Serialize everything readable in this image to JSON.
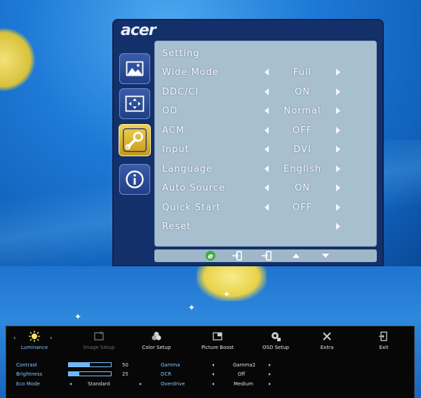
{
  "osd": {
    "brand": "acer",
    "title": "Setting",
    "sidebar": [
      {
        "icon": "picture-icon"
      },
      {
        "icon": "screen-position-icon"
      },
      {
        "icon": "wrench-settings-icon",
        "active": true
      },
      {
        "icon": "info-icon"
      }
    ],
    "rows": [
      {
        "label": "Wide Mode",
        "value": "Full"
      },
      {
        "label": "DDC/CI",
        "value": "ON"
      },
      {
        "label": "OD",
        "value": "Normal"
      },
      {
        "label": "ACM",
        "value": "OFF"
      },
      {
        "label": "Input",
        "value": "DVI"
      },
      {
        "label": "Language",
        "value": "English"
      },
      {
        "label": "Auto Source",
        "value": "ON"
      },
      {
        "label": "Quick Start",
        "value": "OFF"
      },
      {
        "label": "Reset",
        "value": ""
      }
    ],
    "nav": [
      "empowering-e-icon",
      "exit-icon",
      "enter-icon",
      "up-icon",
      "down-icon"
    ]
  },
  "bar": {
    "tabs": [
      {
        "label": "Luminance",
        "icon": "sun-icon",
        "state": "active"
      },
      {
        "label": "Image Setup",
        "icon": "image-setup-icon",
        "state": "dim"
      },
      {
        "label": "Color Setup",
        "icon": "color-icon",
        "state": "normal"
      },
      {
        "label": "Picture Boost",
        "icon": "picture-boost-icon",
        "state": "normal"
      },
      {
        "label": "OSD Setup",
        "icon": "osd-setup-icon",
        "state": "normal"
      },
      {
        "label": "Extra",
        "icon": "tools-icon",
        "state": "normal"
      },
      {
        "label": "Exit",
        "icon": "exit-door-icon",
        "state": "normal"
      }
    ],
    "contrast": {
      "label": "Contrast",
      "value": "50",
      "level": 0.5
    },
    "brightness": {
      "label": "Brightness",
      "value": "25",
      "level": 0.25
    },
    "eco": {
      "label": "Eco Mode",
      "value": "Standard"
    },
    "gamma": {
      "label": "Gamma",
      "value": "Gamma2"
    },
    "dcr": {
      "label": "DCR",
      "value": "Off"
    },
    "overdrive": {
      "label": "Overdrive",
      "value": "Medium"
    }
  },
  "colors": {
    "osd_frame": "#14306b",
    "osd_panel": "#a8bfcf",
    "active_tab": "#7fc8ff",
    "bar_bg": "#070707"
  }
}
